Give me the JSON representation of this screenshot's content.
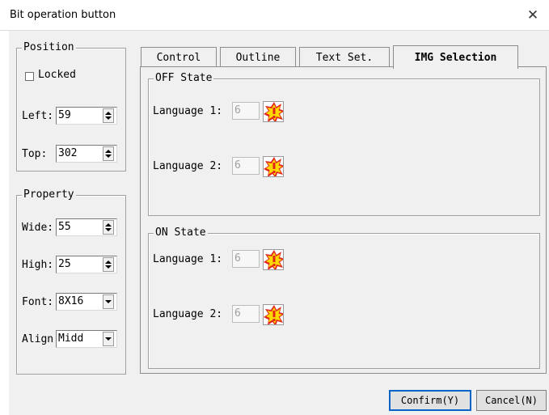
{
  "window": {
    "title": "Bit operation button",
    "close_glyph": "✕"
  },
  "position": {
    "legend": "Position",
    "locked_label": "Locked",
    "locked_checked": false,
    "left_label": "Left:",
    "left_value": "59",
    "top_label": "Top:",
    "top_value": "302"
  },
  "property": {
    "legend": "Property",
    "wide_label": "Wide:",
    "wide_value": "55",
    "high_label": "High:",
    "high_value": "25",
    "font_label": "Font:",
    "font_value": "8X16",
    "align_label": "Align",
    "align_value": "Midd"
  },
  "tabs": [
    {
      "label": "Control"
    },
    {
      "label": "Outline"
    },
    {
      "label": "Text Set."
    },
    {
      "label": "IMG Selection"
    }
  ],
  "active_tab": 3,
  "img_selection": {
    "off_state": {
      "legend": "OFF State",
      "lang1_label": "Language 1:",
      "lang1_value": "6",
      "lang2_label": "Language 2:",
      "lang2_value": "6"
    },
    "on_state": {
      "legend": "ON State",
      "lang1_label": "Language 1:",
      "lang1_value": "6",
      "lang2_label": "Language 2:",
      "lang2_value": "6"
    }
  },
  "buttons": {
    "confirm": "Confirm(Y)",
    "cancel": "Cancel(N)"
  },
  "colors": {
    "dialog_bg": "#f0f0f0",
    "default_button_border": "#0a63c8",
    "warn_yellow": "#ffd800",
    "warn_red": "#e0261c"
  }
}
